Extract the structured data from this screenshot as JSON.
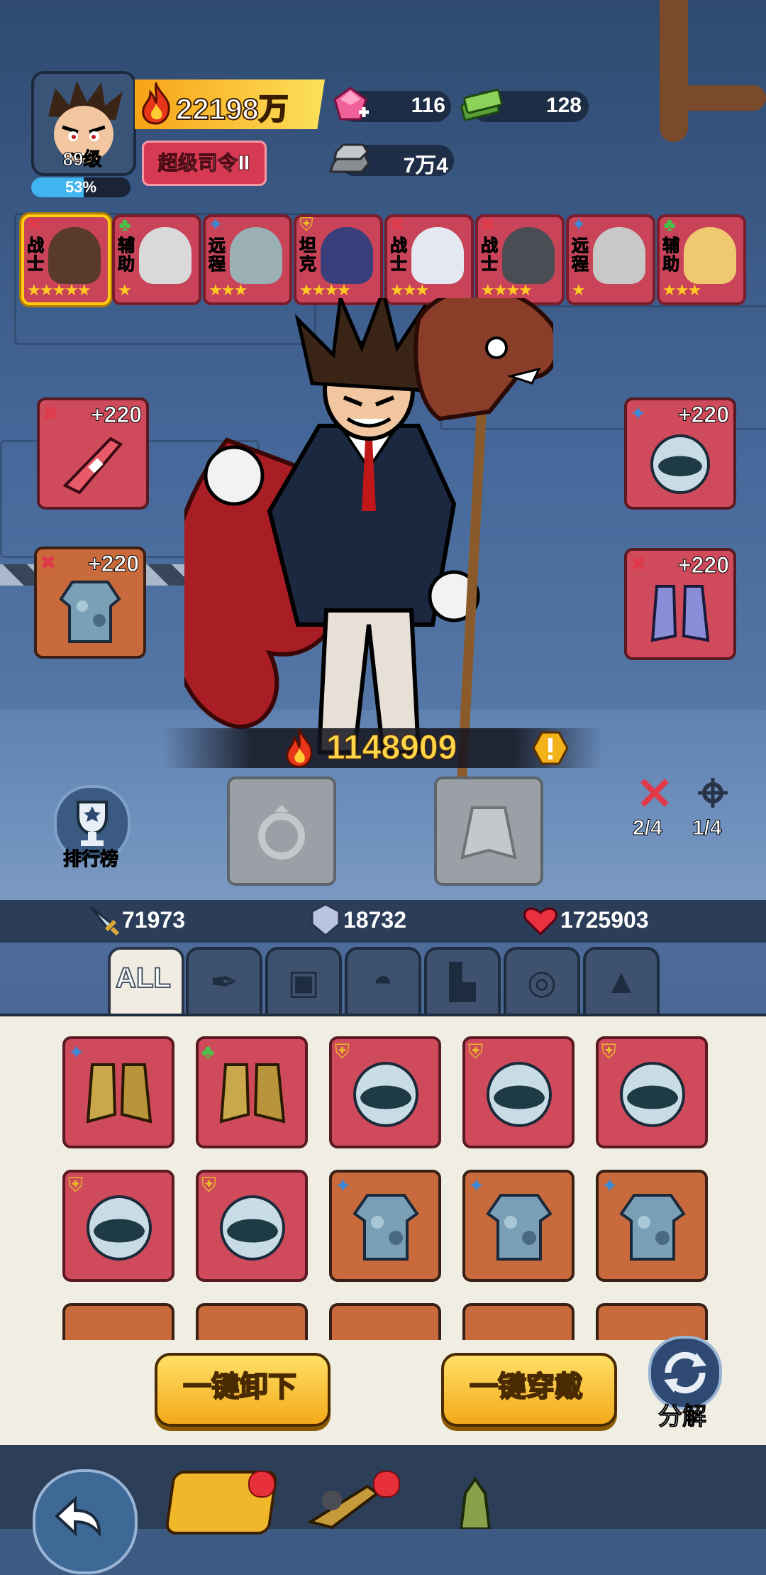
{
  "header": {
    "level": "89级",
    "exp_percent": 53,
    "exp_label": "53%",
    "power": "22198万",
    "rank": "超级司令Ⅱ",
    "resources": [
      {
        "name": "gem",
        "value": "116",
        "color": "#f0609a"
      },
      {
        "name": "cash",
        "value": "128",
        "color": "#7cc24a"
      },
      {
        "name": "iron",
        "value": "7万4",
        "color": "#a0a4aa"
      }
    ]
  },
  "heroes": [
    {
      "role": "战士",
      "stars": "★★★★★",
      "class_icon": "sword",
      "selected": true,
      "face_color": "#5a3a2a"
    },
    {
      "role": "辅助",
      "stars": "★",
      "class_icon": "clover",
      "selected": false,
      "face_color": "#d9d9d9"
    },
    {
      "role": "远程",
      "stars": "★★★",
      "class_icon": "crosshair",
      "selected": false,
      "face_color": "#9ab0b4"
    },
    {
      "role": "坦克",
      "stars": "★★★★",
      "class_icon": "shield",
      "selected": false,
      "face_color": "#3a3e7a"
    },
    {
      "role": "战士",
      "stars": "★★★",
      "class_icon": "sword",
      "selected": false,
      "face_color": "#e4e8f0"
    },
    {
      "role": "战士",
      "stars": "★★★★",
      "class_icon": "sword",
      "selected": false,
      "face_color": "#4a4e54"
    },
    {
      "role": "远程",
      "stars": "★",
      "class_icon": "crosshair",
      "selected": false,
      "face_color": "#c8c8c8"
    },
    {
      "role": "辅助",
      "stars": "★★★",
      "class_icon": "clover",
      "selected": false,
      "face_color": "#f0c870"
    }
  ],
  "equipment": {
    "weapon": {
      "bonus": "+220",
      "class_icon": "sword",
      "item_icon": "rifle-icon"
    },
    "armor": {
      "bonus": "+220",
      "class_icon": "sword",
      "item_icon": "camo-armor-icon"
    },
    "helmet": {
      "bonus": "+220",
      "class_icon": "crosshair",
      "item_icon": "helmet-icon"
    },
    "boots": {
      "bonus": "+220",
      "class_icon": "sword",
      "item_icon": "boots-icon"
    }
  },
  "combat_power": "1148909",
  "ranking_label": "排行榜",
  "set_counts": [
    {
      "icon": "sword",
      "value": "2/4"
    },
    {
      "icon": "crosshair",
      "value": "1/4"
    }
  ],
  "stats": {
    "attack": "71973",
    "defense": "18732",
    "hp": "1725903"
  },
  "tabs": [
    {
      "label": "ALL",
      "icon": "all"
    },
    {
      "label": "",
      "icon": "weapon-tab-icon"
    },
    {
      "label": "",
      "icon": "armor-tab-icon"
    },
    {
      "label": "",
      "icon": "helmet-tab-icon"
    },
    {
      "label": "",
      "icon": "boots-tab-icon"
    },
    {
      "label": "",
      "icon": "ring-tab-icon"
    },
    {
      "label": "",
      "icon": "cloak-tab-icon"
    }
  ],
  "inventory": [
    {
      "item": "boots-icon",
      "class_icon": "crosshair",
      "frame": "red"
    },
    {
      "item": "boots-icon",
      "class_icon": "clover",
      "frame": "red"
    },
    {
      "item": "helmet-icon",
      "class_icon": "shield",
      "frame": "red"
    },
    {
      "item": "helmet-icon",
      "class_icon": "shield",
      "frame": "red"
    },
    {
      "item": "helmet-icon",
      "class_icon": "shield",
      "frame": "red"
    },
    {
      "item": "helmet-icon",
      "class_icon": "shield",
      "frame": "red"
    },
    {
      "item": "helmet-icon",
      "class_icon": "shield",
      "frame": "red"
    },
    {
      "item": "camo-armor-icon",
      "class_icon": "crosshair",
      "frame": "orange"
    },
    {
      "item": "camo-armor-icon",
      "class_icon": "crosshair",
      "frame": "orange"
    },
    {
      "item": "camo-armor-icon",
      "class_icon": "crosshair",
      "frame": "orange"
    }
  ],
  "actions": {
    "unequip_all": "一键卸下",
    "equip_all": "一键穿戴",
    "decompose": "分解"
  }
}
